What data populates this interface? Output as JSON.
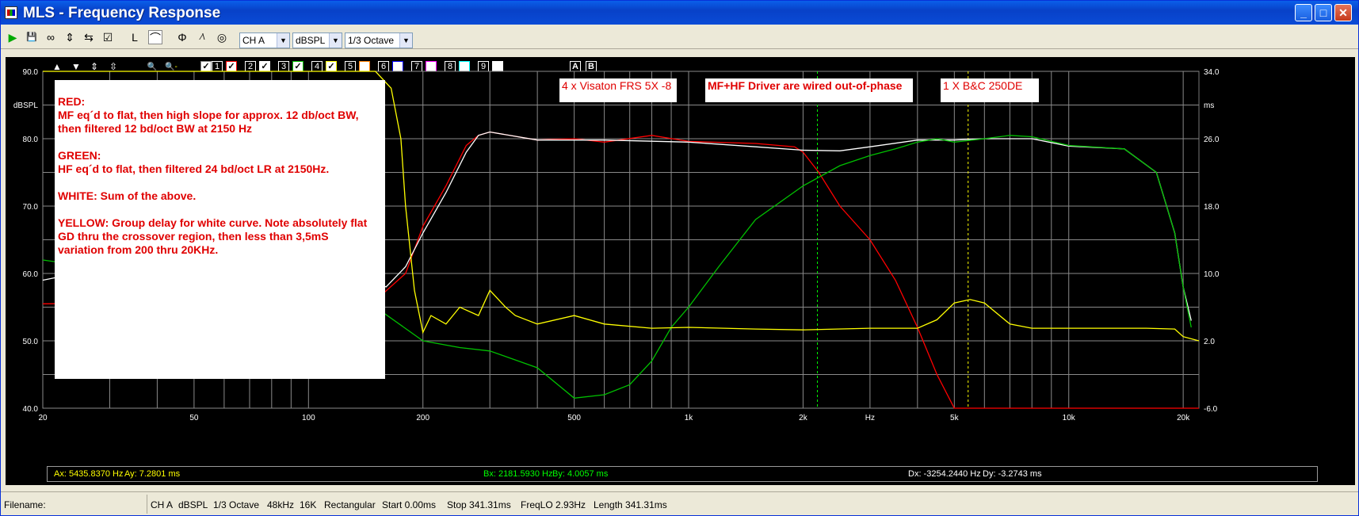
{
  "window": {
    "title": "MLS - Frequency Response",
    "icon": "app-icon"
  },
  "titlebar_buttons": {
    "minimize": "_",
    "maximize": "□",
    "close": "✕"
  },
  "toolbar": {
    "tools": [
      "▶",
      "💾",
      "∞",
      "⇕",
      "⇆",
      "☑",
      "L",
      "⌒",
      "Φ",
      "⁄\\",
      "◎"
    ],
    "channel": "CH A",
    "unit": "dBSPL",
    "smoothing": "1/3 Octave"
  },
  "plot_controls": {
    "arrows": [
      "▲",
      "▼",
      "⇕",
      "⇳"
    ],
    "zoom": [
      "🔍+",
      "🔍-"
    ],
    "traces": [
      {
        "num": "1",
        "color": "#FF0000"
      },
      {
        "num": "2",
        "color": "#FFFFFF"
      },
      {
        "num": "3",
        "color": "#00C000"
      },
      {
        "num": "4",
        "color": "#FFFF00"
      },
      {
        "num": "5",
        "color": "#FF8000"
      },
      {
        "num": "6",
        "color": "#0000FF"
      },
      {
        "num": "7",
        "color": "#FF00FF"
      },
      {
        "num": "8",
        "color": "#00FFFF"
      },
      {
        "num": "9",
        "color": "#FFFFFF"
      }
    ],
    "ab": [
      "A",
      "B"
    ]
  },
  "chart_data": {
    "type": "line",
    "xscale": "log",
    "xlim": [
      20,
      22000
    ],
    "ylim_left": [
      40,
      90
    ],
    "ylim_right": [
      -6,
      34
    ],
    "ylabel_left": "dBSPL",
    "ylabel_right": "ms",
    "xlabel": "Hz",
    "y_ticks_left": [
      "90.0",
      "80.0",
      "70.0",
      "60.0",
      "50.0",
      "40.0"
    ],
    "y_ticks_right": [
      "34.0",
      "26.0",
      "18.0",
      "10.0",
      "2.0",
      "-6.0"
    ],
    "x_ticks": [
      "20",
      "50",
      "100",
      "200",
      "500",
      "1k",
      "2k",
      "Hz",
      "5k",
      "10k",
      "20k"
    ],
    "grid": true,
    "cursors": [
      2181.59,
      5435.84
    ],
    "series": [
      {
        "color": "#FF0000",
        "axis": "left",
        "x": [
          20,
          150,
          180,
          200,
          230,
          260,
          280,
          300,
          400,
          500,
          600,
          800,
          1000,
          1500,
          1900,
          2000,
          2200,
          2500,
          3000,
          3500,
          4000,
          4500,
          5000,
          6000,
          22000
        ],
        "y": [
          55.5,
          56,
          60,
          67,
          73,
          79,
          80.5,
          81,
          79.8,
          80,
          79.5,
          80.5,
          79.6,
          79.3,
          78.8,
          78,
          75,
          70,
          65,
          59,
          52,
          45,
          40,
          40,
          40
        ]
      },
      {
        "color": "#FFFFFF",
        "axis": "left",
        "x": [
          20,
          30,
          60,
          120,
          160,
          180,
          200,
          230,
          260,
          280,
          300,
          400,
          600,
          1000,
          1500,
          2000,
          2500,
          3000,
          4000,
          5000,
          6000,
          8000,
          10000,
          14000,
          17000,
          19000,
          20000,
          21000
        ],
        "y": [
          59,
          61,
          62,
          61,
          58,
          61,
          66,
          72,
          78,
          80.5,
          81,
          79.8,
          79.8,
          79.5,
          78.8,
          78.3,
          78.2,
          78.8,
          79.8,
          79.8,
          80,
          80,
          78.9,
          78.5,
          75,
          66,
          58,
          53
        ]
      },
      {
        "color": "#00C000",
        "axis": "left",
        "x": [
          20,
          150,
          200,
          250,
          300,
          400,
          500,
          600,
          700,
          800,
          900,
          1000,
          1200,
          1500,
          2000,
          2500,
          3000,
          3500,
          4000,
          4500,
          5000,
          6000,
          7000,
          8000,
          10000,
          14000,
          17000,
          19000,
          20000,
          21000
        ],
        "y": [
          62,
          55,
          50,
          49,
          48.5,
          46,
          41.5,
          42,
          43.5,
          47,
          52,
          55,
          61,
          68,
          73,
          76,
          77.5,
          78.5,
          79.5,
          80,
          79.5,
          80,
          80.5,
          80.3,
          79,
          78.5,
          75,
          66,
          58,
          52
        ]
      },
      {
        "color": "#FFFF00",
        "axis": "right",
        "x": [
          20,
          120,
          150,
          165,
          175,
          180,
          190,
          200,
          210,
          230,
          250,
          280,
          300,
          330,
          350,
          400,
          500,
          600,
          800,
          1000,
          1500,
          2000,
          3000,
          4000,
          4500,
          5000,
          5500,
          6000,
          7000,
          8000,
          12000,
          16000,
          19000,
          20000,
          22000
        ],
        "y": [
          34,
          34,
          34,
          32,
          26,
          18,
          8,
          3,
          5,
          4,
          6,
          5,
          8,
          6,
          5,
          4,
          5,
          4,
          3.5,
          3.6,
          3.4,
          3.3,
          3.5,
          3.5,
          4.5,
          6.5,
          6.9,
          6.5,
          4,
          3.5,
          3.5,
          3.5,
          3.4,
          2.5,
          2
        ]
      }
    ]
  },
  "annotations": {
    "note": {
      "red_title": "RED:",
      "red_text": "MF eq´d to flat, then high slope for approx. 12 db/oct BW,\nthen filtered 12 bd/oct BW at 2150 Hz",
      "green_title": "GREEN:",
      "green_text": "HF eq´d to flat, then filtered 24 bd/oct LR at 2150Hz.",
      "white_text": "WHITE:  Sum of the above.",
      "yellow_text": "YELLOW: Group delay for white curve. Note absolutely flat\nGD thru the crossover region, then less than 3,5mS\nvariation from 200 thru 20KHz."
    },
    "tag_mf": "4 x Visaton FRS 5X -8",
    "tag_phase": "MF+HF Driver are wired out-of-phase",
    "tag_hf": "1 X B&C 250DE"
  },
  "cursor_readout": {
    "a_x": "Ax: 5435.8370 Hz",
    "a_y": "Ay: 7.2801 ms",
    "b_x": "Bx: 2181.5930 Hz",
    "b_y": "By: 4.0057 ms",
    "dx": "Dx: -3254.2440 Hz",
    "dy": "Dy: -3.2743 ms"
  },
  "status": {
    "filename_label": "Filename:",
    "channel": "CH A",
    "unit": "dBSPL",
    "smoothing": "1/3 Octave",
    "rate": "48kHz",
    "length_pts": "16K",
    "window": "Rectangular",
    "start": "Start 0.00ms",
    "stop": "Stop 341.31ms",
    "freqlo": "FreqLO 2.93Hz",
    "length": "Length 341.31ms"
  }
}
